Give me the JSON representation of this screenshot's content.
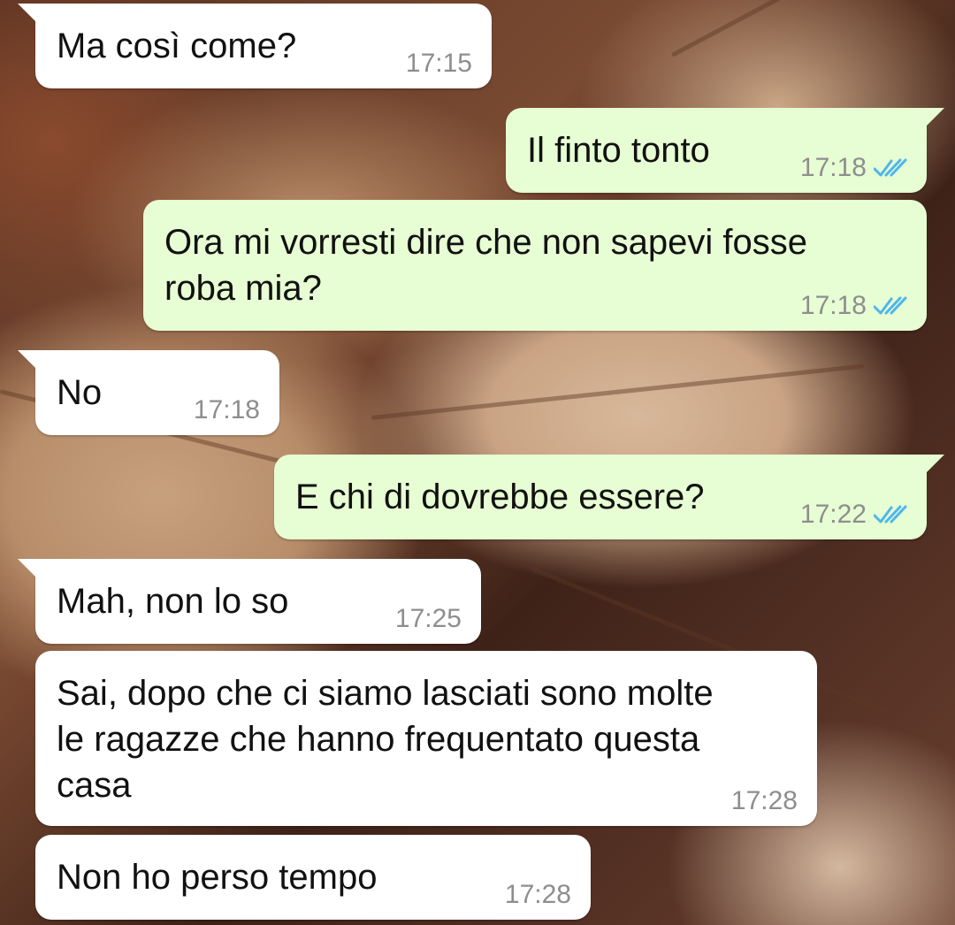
{
  "chat": {
    "messages": [
      {
        "direction": "incoming",
        "text": "Ma così come?",
        "time": "17:15"
      },
      {
        "direction": "outgoing",
        "text": "Il finto tonto",
        "time": "17:18",
        "status": "read"
      },
      {
        "direction": "outgoing",
        "text": "Ora mi vorresti dire che non sapevi fosse\nroba mia?",
        "time": "17:18",
        "status": "read"
      },
      {
        "direction": "incoming",
        "text": "No",
        "time": "17:18"
      },
      {
        "direction": "outgoing",
        "text": "E chi di dovrebbe essere?",
        "time": "17:22",
        "status": "read"
      },
      {
        "direction": "incoming",
        "text": "Mah, non lo so",
        "time": "17:25"
      },
      {
        "direction": "incoming",
        "text": "Sai, dopo che ci siamo lasciati sono molte\nle ragazze che hanno frequentato questa\ncasa",
        "time": "17:28"
      },
      {
        "direction": "incoming",
        "text": "Non ho perso tempo",
        "time": "17:28"
      }
    ]
  },
  "icons": {
    "read_receipt": "double-check-icon"
  },
  "colors": {
    "incoming_bubble": "#ffffff",
    "outgoing_bubble": "#e7fdd3",
    "timestamp": "#8e8e8e",
    "read_check": "#4fb6ec"
  }
}
